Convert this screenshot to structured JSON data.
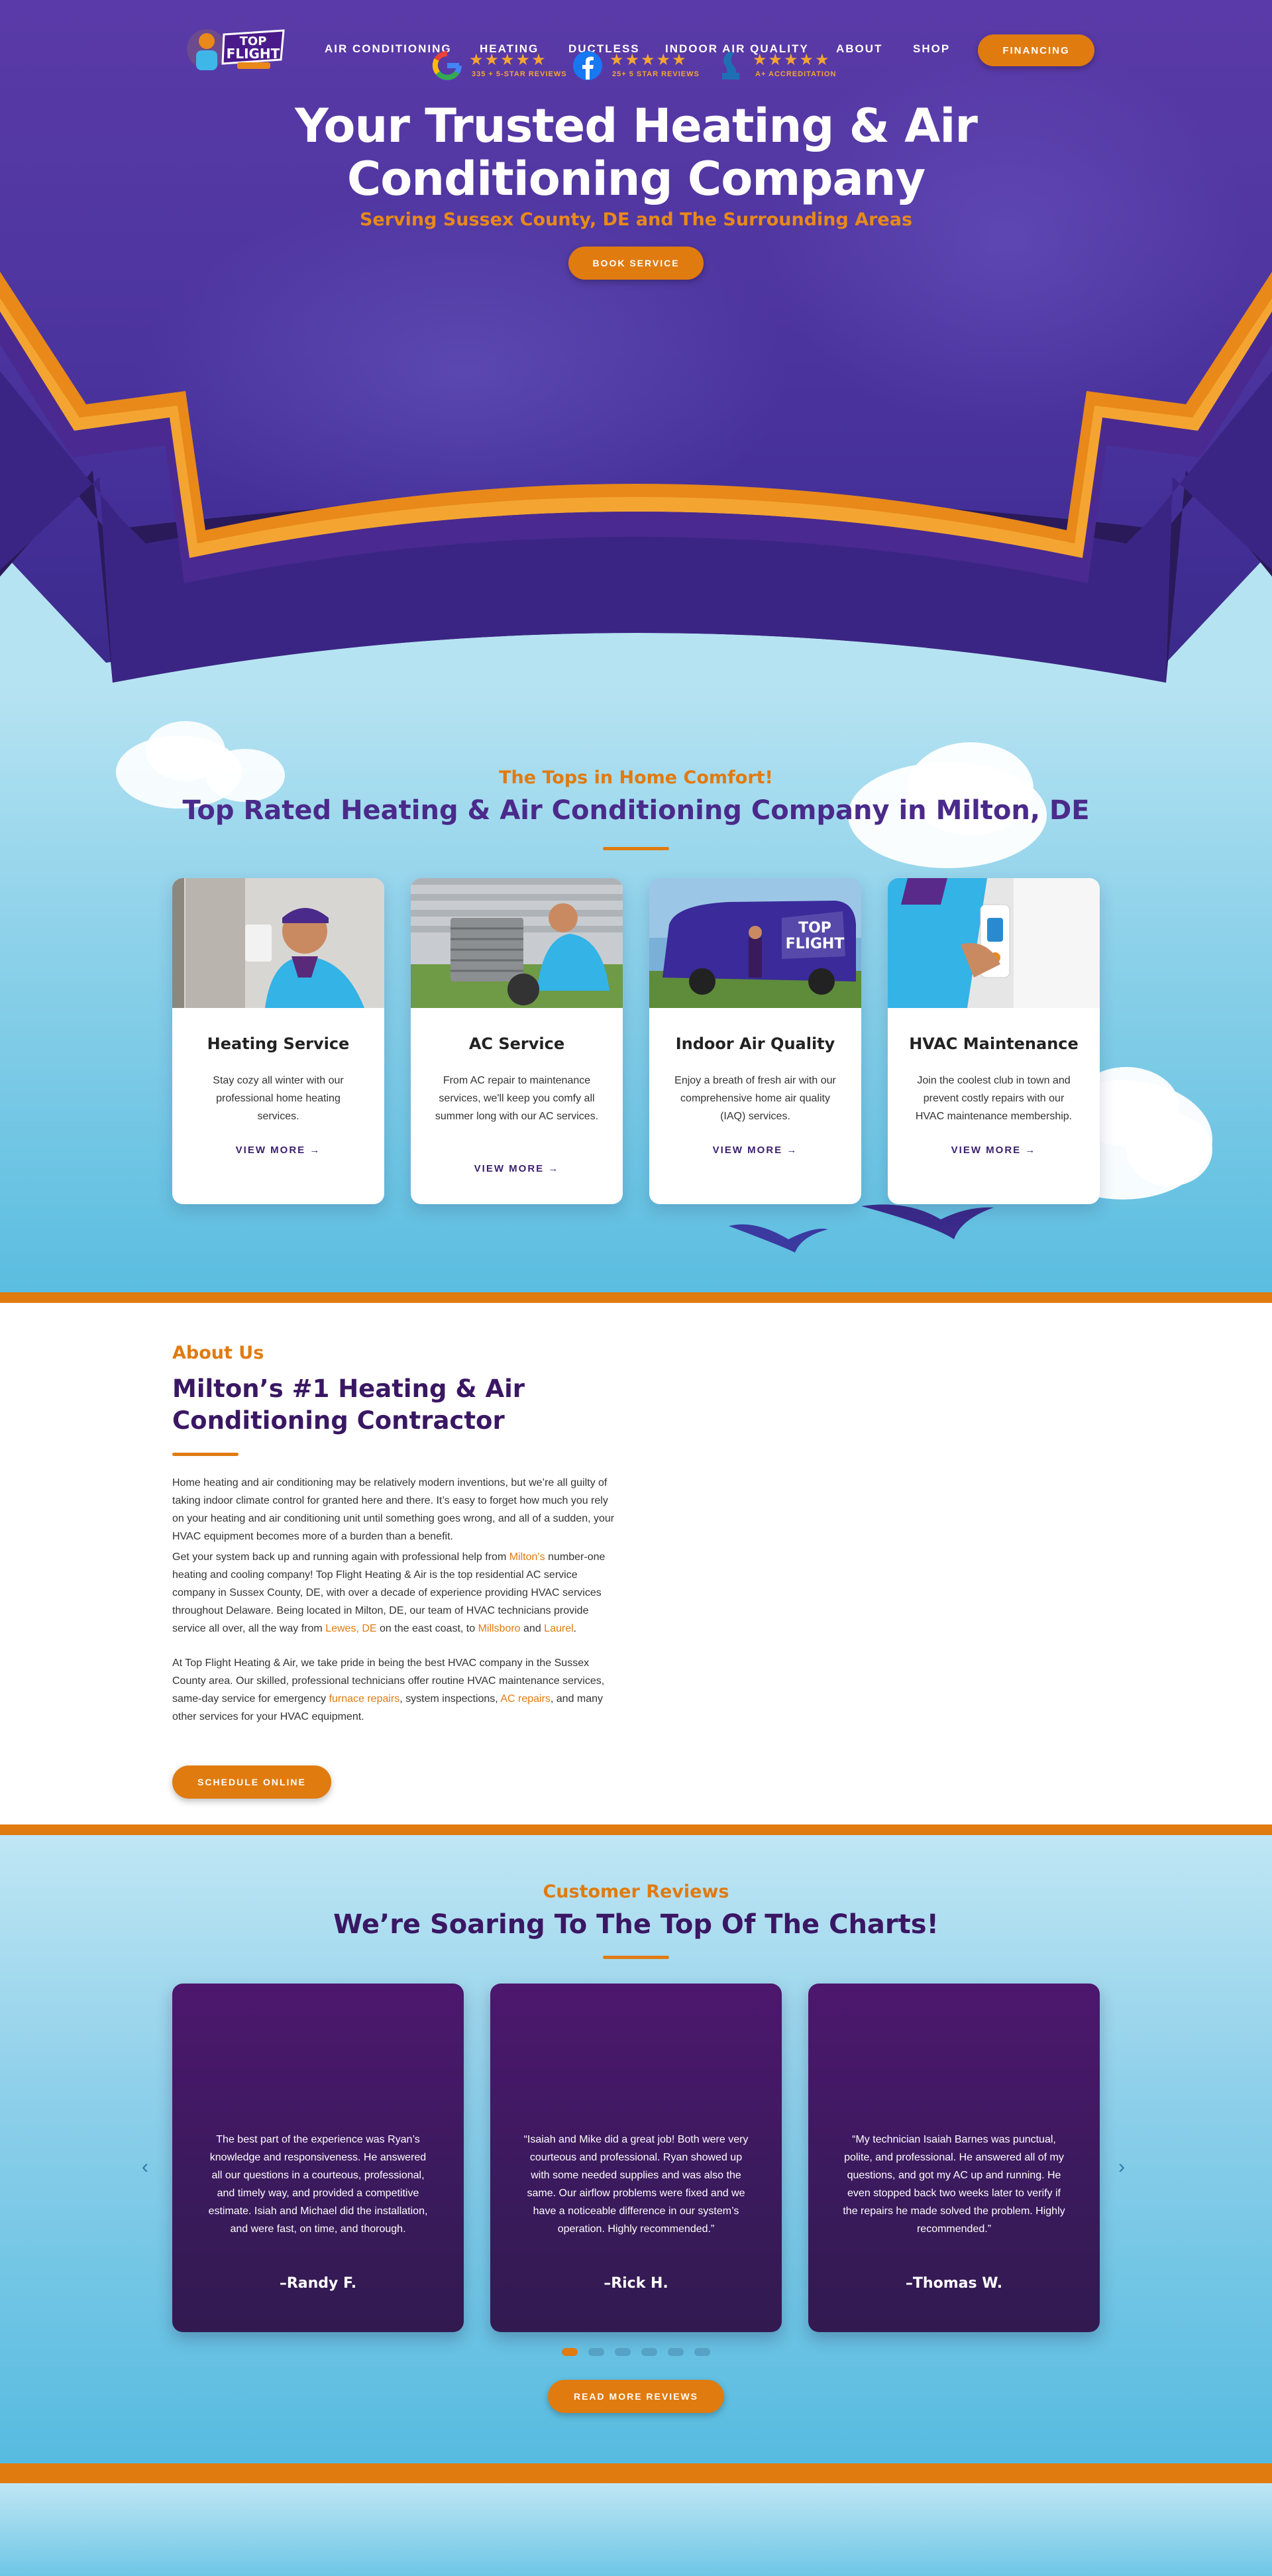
{
  "nav": {
    "links": [
      "AIR CONDITIONING",
      "HEATING",
      "DUCTLESS",
      "INDOOR AIR QUALITY",
      "ABOUT",
      "SHOP"
    ],
    "cta": "FINANCING",
    "logo_top": "TOP",
    "logo_bottom": "FLIGHT"
  },
  "badges": [
    {
      "icon": "google-icon",
      "stars": "★★★★★",
      "label": "335 + 5-STAR REVIEWS"
    },
    {
      "icon": "facebook-icon",
      "stars": "★★★★★",
      "label": "25+ 5 STAR REVIEWS"
    },
    {
      "icon": "bbb-icon",
      "stars": "★★★★★",
      "label": "A+ ACCREDITATION"
    }
  ],
  "hero": {
    "title_line1": "Your Trusted Heating & Air",
    "title_line2": "Conditioning Company",
    "subtitle": "Serving Sussex County, DE and The Surrounding Areas",
    "cta": "BOOK SERVICE"
  },
  "services": {
    "kicker": "The Tops in Home Comfort!",
    "title": "Top Rated Heating & Air Conditioning Company in Milton, DE",
    "cards": [
      {
        "title": "Heating Service",
        "text": "Stay cozy all winter with our professional home heating services.",
        "link": "VIEW MORE →"
      },
      {
        "title": "AC Service",
        "text": "From AC repair to maintenance services, we'll keep you comfy all summer long with our AC services.",
        "link": "VIEW MORE →"
      },
      {
        "title": "Indoor Air Quality",
        "text": "Enjoy a breath of fresh air with our comprehensive home air quality (IAQ) services.",
        "link": "VIEW MORE →"
      },
      {
        "title": "HVAC Maintenance",
        "text": "Join the coolest club in town and prevent costly repairs with our HVAC maintenance membership.",
        "link": "VIEW MORE →"
      }
    ]
  },
  "about": {
    "kicker": "About Us",
    "title": "Milton’s #1 Heating & Air Conditioning Contractor",
    "p1": "Home heating and air conditioning may be relatively modern inventions, but we’re all guilty of taking indoor climate control for granted here and there. It’s easy to forget how much you rely on your heating and air conditioning unit until something goes wrong, and all of a sudden, your HVAC equipment becomes more of a burden than a benefit.",
    "p2_a": "Get your system back up and running again with professional help from ",
    "p2_link1": "Milton’s",
    "p2_b": " number-one heating and cooling company! Top Flight Heating & Air is the top residential AC service company in Sussex County, DE, with over a decade of experience providing HVAC services throughout Delaware. Being located in Milton, DE, our team of HVAC technicians provide service all over, all the way from ",
    "p2_link2": "Lewes, DE",
    "p2_c": " on the east coast, to ",
    "p2_link3": "Millsboro",
    "p2_d": " and ",
    "p2_link4": "Laurel",
    "p2_e": ".",
    "p3_a": "At Top Flight Heating & Air, we take pride in being the best HVAC company in the Sussex County area. Our skilled, professional technicians offer routine HVAC maintenance services, same-day service for emergency ",
    "p3_link1": "furnace repairs",
    "p3_b": ", system inspections, ",
    "p3_link2": "AC repairs",
    "p3_c": ", and many other services for your HVAC equipment.",
    "cta": "SCHEDULE ONLINE"
  },
  "reviews": {
    "kicker": "Customer Reviews",
    "title": "We’re Soaring To The Top Of The Charts!",
    "items": [
      {
        "text": "The best part of the experience was Ryan’s knowledge and responsiveness. He answered all our questions in a courteous, professional, and timely way, and provided a competitive estimate. Isiah and Michael did the installation, and were fast, on time, and thorough.",
        "author": "–Randy F."
      },
      {
        "text": "“Isaiah and Mike did a great job! Both were very courteous and professional. Ryan showed up with some needed supplies and was also the same. Our airflow problems were fixed and we have a noticeable difference in our system’s operation. Highly recommended.”",
        "author": "–Rick H."
      },
      {
        "text": "“My technician Isaiah Barnes was punctual, polite, and professional. He answered all of my questions, and got my AC up and running. He even stopped back two weeks later to verify if the repairs he made solved the problem. Highly recommended.”",
        "author": "–Thomas W."
      }
    ],
    "prev": "‹",
    "next": "›",
    "cta": "READ MORE REVIEWS",
    "active_slide": 1,
    "slide_count": 6
  },
  "colors": {
    "purple": "#4a2a8a",
    "orange": "#e07b10",
    "sky": "#5bbde0"
  }
}
